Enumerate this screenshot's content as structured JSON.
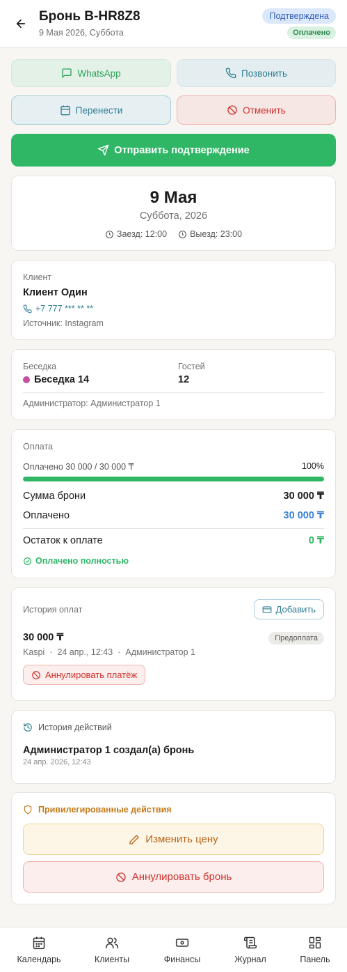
{
  "header": {
    "title": "Бронь B-HR8Z8",
    "subtitle": "9 Мая 2026, Суббота",
    "status_badge": "Подтверждена",
    "payment_badge": "Оплачено"
  },
  "actions": {
    "whatsapp": "WhatsApp",
    "call": "Позвонить",
    "reschedule": "Перенести",
    "cancel": "Отменить",
    "send_confirmation": "Отправить подтверждение"
  },
  "date_card": {
    "date": "9 Мая",
    "weekday_year": "Суббота, 2026",
    "checkin": "Заезд: 12:00",
    "checkout": "Выезд: 23:00"
  },
  "client": {
    "label": "Клиент",
    "name": "Клиент Один",
    "phone": "+7 777 *** ** **",
    "source": "Источник: Instagram"
  },
  "gazebo": {
    "label": "Беседка",
    "name": "Беседка 14",
    "dot_color": "#c4509e",
    "guests_label": "Гостей",
    "guests": "12",
    "admin": "Администратор: Администратор 1"
  },
  "payment": {
    "label": "Оплата",
    "progress_text": "Оплачено 30 000 / 30 000 ₸",
    "progress_percent_text": "100%",
    "progress_fraction": 1.0,
    "total_label": "Сумма брони",
    "total_value": "30 000 ₸",
    "paid_label": "Оплачено",
    "paid_value": "30 000 ₸",
    "remaining_label": "Остаток к оплате",
    "remaining_value": "0 ₸",
    "status": "Оплачено полностью"
  },
  "payment_history": {
    "label": "История оплат",
    "add_button": "Добавить",
    "items": [
      {
        "amount": "30 000 ₸",
        "tag": "Предоплата",
        "method": "Kaspi",
        "datetime": "24 апр., 12:43",
        "admin": "Администратор 1",
        "void_button": "Аннулировать платёж"
      }
    ]
  },
  "action_history": {
    "label": "История действий",
    "items": [
      {
        "text": "Администратор 1 создал(а) бронь",
        "datetime": "24 апр. 2026, 12:43"
      }
    ]
  },
  "privileged": {
    "label": "Привилегированные действия",
    "change_price": "Изменить цену",
    "void_booking": "Аннулировать бронь"
  },
  "nav": {
    "items": [
      {
        "label": "Календарь",
        "icon": "calendar-icon"
      },
      {
        "label": "Клиенты",
        "icon": "users-icon"
      },
      {
        "label": "Финансы",
        "icon": "banknote-icon"
      },
      {
        "label": "Журнал",
        "icon": "scroll-icon"
      },
      {
        "label": "Панель",
        "icon": "dashboard-icon"
      }
    ]
  },
  "colors": {
    "accent_green": "#2fb766",
    "accent_blue": "#2f7f94",
    "danger": "#d0342f",
    "warning": "#b8641b"
  }
}
